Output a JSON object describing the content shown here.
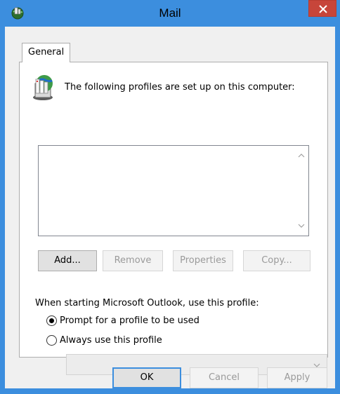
{
  "window": {
    "title": "Mail",
    "icon": "mail-profile-icon",
    "close_icon": "close-icon"
  },
  "tabs": [
    {
      "label": "General",
      "selected": true
    }
  ],
  "profiles": {
    "heading": "The following profiles are set up on this computer:",
    "icon": "profiles-icon",
    "items": []
  },
  "buttons": {
    "add": "Add...",
    "remove": "Remove",
    "properties": "Properties",
    "copy": "Copy..."
  },
  "startup": {
    "label": "When starting Microsoft Outlook, use this profile:",
    "options": [
      {
        "label": "Prompt for a profile to be used",
        "checked": true
      },
      {
        "label": "Always use this profile",
        "checked": false
      }
    ],
    "selected_profile": ""
  },
  "footer": {
    "ok": "OK",
    "cancel": "Cancel",
    "apply": "Apply"
  },
  "colors": {
    "title_bar": "#3c8ede",
    "close_button": "#c7453a",
    "dialog_background": "#f0f0f0"
  }
}
